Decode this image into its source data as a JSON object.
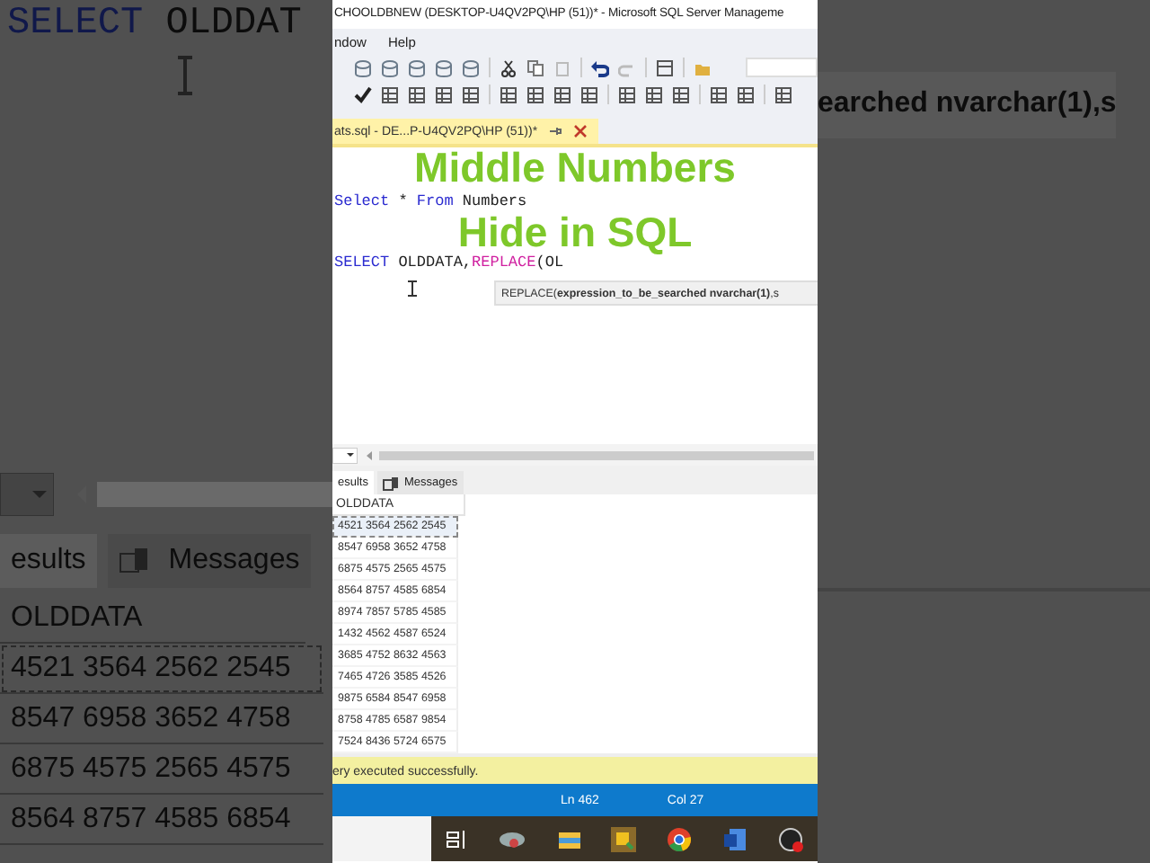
{
  "background_left": {
    "code": [
      {
        "kind": "keyword",
        "text": "SELECT"
      },
      {
        "kind": "plain",
        "text": " OLDDAT"
      }
    ],
    "tabs": [
      {
        "label": "esults",
        "selected": true
      },
      {
        "label": "Messages",
        "selected": false
      }
    ],
    "column": "OLDDATA",
    "rows": [
      {
        "value": "4521 3564 2562 2545",
        "selected": true
      },
      {
        "value": "8547 6958 3652 4758",
        "selected": false
      },
      {
        "value": "6875 4575 2565 4575",
        "selected": false
      },
      {
        "value": "8564 8757 4585 6854",
        "selected": false
      }
    ]
  },
  "window": {
    "title": "CHOOLDBNEW (DESKTOP-U4QV2PQ\\HP (51))* - Microsoft SQL Server Manageme",
    "menu": [
      "ndow",
      "Help"
    ]
  },
  "document_tab": {
    "label": "ats.sql - DE...P-U4QV2PQ\\HP (51))*",
    "selected": true
  },
  "editor": {
    "lines": [
      [
        {
          "kind": "keyword",
          "text": "Select"
        },
        {
          "kind": "plain",
          "text": " * "
        },
        {
          "kind": "keyword",
          "text": "From"
        },
        {
          "kind": "plain",
          "text": " Numbers"
        }
      ],
      [
        {
          "kind": "keyword",
          "text": "SELECT"
        },
        {
          "kind": "plain",
          "text": " OLDDATA,"
        },
        {
          "kind": "function",
          "text": "REPLACE"
        },
        {
          "kind": "plain",
          "text": "(OL"
        }
      ]
    ],
    "tooltip": "REPLACE(**expression_to_be_searched nvarchar(1)**,s"
  },
  "overlay_title": [
    "Middle Numbers",
    "Hide in SQL"
  ],
  "results": {
    "tabs": [
      {
        "label": "esults",
        "selected": true
      },
      {
        "label": "Messages",
        "selected": false
      }
    ],
    "column": "OLDDATA",
    "rows": [
      {
        "value": "4521 3564 2562 2545",
        "selected": true
      },
      {
        "value": "8547 6958 3652 4758",
        "selected": false
      },
      {
        "value": "6875 4575 2565 4575",
        "selected": false
      },
      {
        "value": "8564 8757 4585 6854",
        "selected": false
      },
      {
        "value": "8974 7857 5785 4585",
        "selected": false
      },
      {
        "value": "1432 4562 4587 6524",
        "selected": false
      },
      {
        "value": "3685 4752 8632 4563",
        "selected": false
      },
      {
        "value": "7465 4726 3585 4526",
        "selected": false
      },
      {
        "value": "9875 6584 8547 6958",
        "selected": false
      },
      {
        "value": "8758 4785 6587 9854",
        "selected": false
      },
      {
        "value": "7524 8436 5724 6575",
        "selected": false
      }
    ]
  },
  "message_bar": "ery executed successfully.",
  "status_bar": {
    "line": "Ln 462",
    "column": "Col 27"
  },
  "background_right": {
    "tooltip": "earched nvarchar(1),s"
  }
}
